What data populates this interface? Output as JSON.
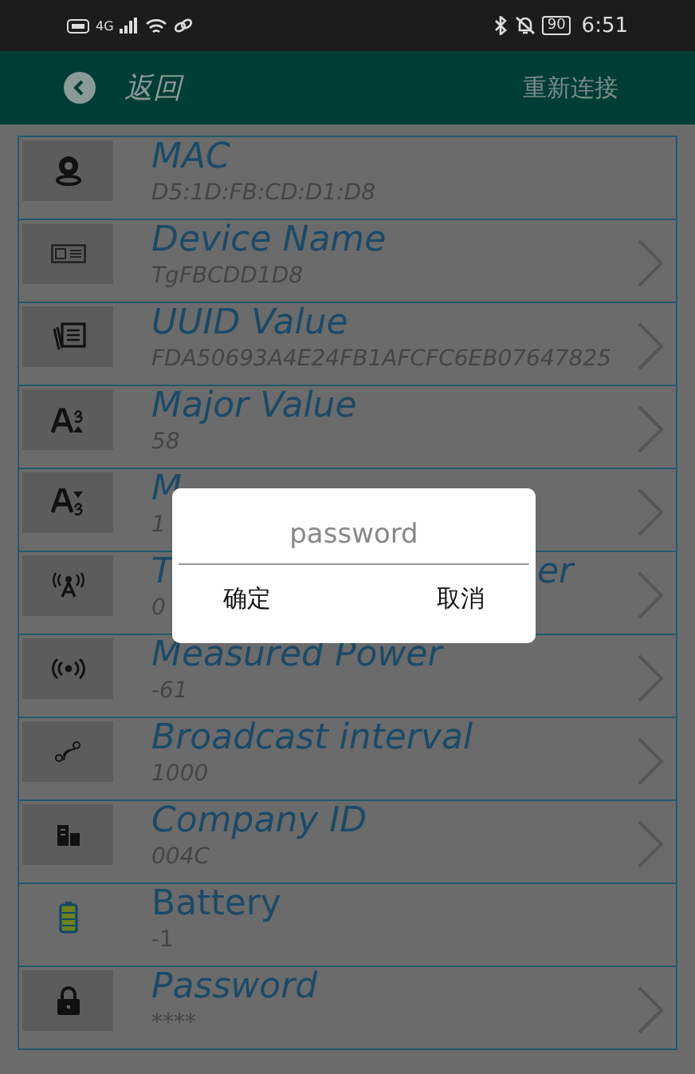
{
  "status_bar": {
    "network": "4G",
    "battery": "90",
    "time": "6:51"
  },
  "header": {
    "back": "返回",
    "reconnect": "重新连接"
  },
  "rows": [
    {
      "title": "MAC",
      "value": "D5:1D:FB:CD:D1:D8",
      "arrow": false,
      "italic": true
    },
    {
      "title": "Device Name",
      "value": "TgFBCDD1D8",
      "arrow": true,
      "italic": true
    },
    {
      "title": "UUID Value",
      "value": "FDA50693A4E24FB1AFCFC6EB07647825",
      "arrow": true,
      "italic": true
    },
    {
      "title": "Major Value",
      "value": "58",
      "arrow": true,
      "italic": true
    },
    {
      "title": "M",
      "value": "1",
      "arrow": true,
      "italic": true
    },
    {
      "title": "T",
      "title_end": "er",
      "value": "0",
      "arrow": true,
      "italic": true
    },
    {
      "title": "Measured Power",
      "value": "-61",
      "arrow": true,
      "italic": true
    },
    {
      "title": "Broadcast interval",
      "value": "1000",
      "arrow": true,
      "italic": true
    },
    {
      "title": "Company ID",
      "value": "004C",
      "arrow": true,
      "italic": true
    },
    {
      "title": "Battery",
      "value": "-1",
      "arrow": false,
      "italic": false
    },
    {
      "title": "Password",
      "value": "****",
      "arrow": true,
      "italic": true
    }
  ],
  "dialog": {
    "placeholder": "password",
    "buttons": [
      "确定",
      "取消"
    ]
  }
}
